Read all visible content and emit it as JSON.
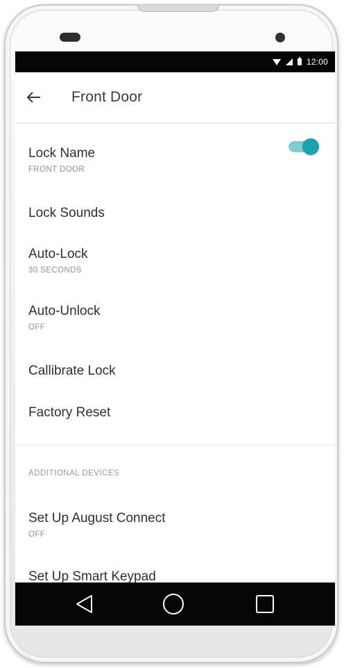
{
  "status_bar": {
    "time": "12:00"
  },
  "header": {
    "title": "Front Door"
  },
  "settings": [
    {
      "title": "Lock Name",
      "subtitle": "FRONT DOOR"
    },
    {
      "title": "Lock Sounds",
      "toggle_on": true
    },
    {
      "title": "Auto-Lock",
      "subtitle": "30 SECONDS"
    },
    {
      "title": "Auto-Unlock",
      "subtitle": "OFF"
    },
    {
      "title": "Callibrate Lock"
    },
    {
      "title": "Factory Reset"
    }
  ],
  "additional_devices": {
    "header": "ADDITIONAL DEVICES",
    "items": [
      {
        "title": "Set Up August Connect",
        "subtitle": "OFF"
      },
      {
        "title": "Set Up Smart Keypad"
      }
    ]
  },
  "colors": {
    "accent": "#1ba2ae",
    "accent_track": "#7fcdd3",
    "text": "#2f2f2f",
    "subtext": "#8f8f8f"
  }
}
